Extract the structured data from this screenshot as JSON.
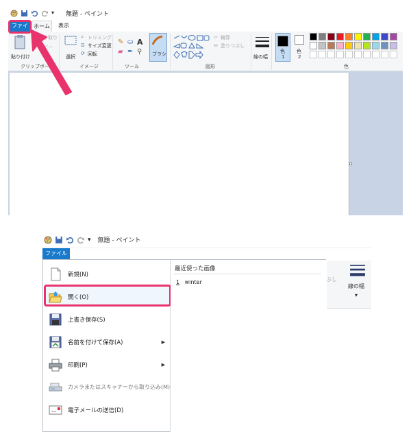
{
  "shot1": {
    "window_title": "無題 - ペイント",
    "tabs": {
      "file": "ファイル",
      "home": "ホーム",
      "view": "表示"
    },
    "ribbon": {
      "paste": "貼り付け",
      "cut": "切り取り",
      "copy": "コピー",
      "select": "選択",
      "crop": "トリミング",
      "resize": "サイズ変更",
      "rotate": "回転",
      "brushes": "ブラシ",
      "outline": "輪郭",
      "fill": "塗りつぶし",
      "size": "線の幅",
      "color1": "色",
      "color1_num": "1",
      "color2": "色",
      "color2_num": "2",
      "groups": {
        "clipboard": "クリップボード",
        "image": "イメージ",
        "tools": "ツール",
        "shapes": "図形",
        "colors": "色"
      }
    },
    "palette": [
      "#000000",
      "#7f7f7f",
      "#880015",
      "#ed1c24",
      "#ff7f27",
      "#fff200",
      "#22b14c",
      "#00a2e8",
      "#3f48cc",
      "#a349a4",
      "#ffffff",
      "#c3c3c3",
      "#b97a57",
      "#ffaec9",
      "#ffc90e",
      "#efe4b0",
      "#b5e61d",
      "#99d9ea",
      "#7092be",
      "#c8bfe7",
      "#ffffff",
      "#ffffff",
      "#ffffff",
      "#ffffff",
      "#ffffff",
      "#ffffff",
      "#ffffff",
      "#ffffff",
      "#ffffff",
      "#ffffff"
    ],
    "accent": "#e8336d"
  },
  "shot2": {
    "window_title": "無題 - ペイント",
    "file_tab": "ファイル",
    "menu_items": [
      {
        "label": "新規(N)"
      },
      {
        "label": "開く(O)"
      },
      {
        "label": "上書き保存(S)"
      },
      {
        "label": "名前を付けて保存(A)"
      },
      {
        "label": "印刷(P)"
      },
      {
        "label": "カメラまたはスキャナーから取り込み(M)"
      },
      {
        "label": "電子メールの送信(D)"
      }
    ],
    "recent": {
      "heading": "最近使った画像",
      "items": [
        {
          "index": "1",
          "name": "winter"
        }
      ]
    },
    "ribbon_peek": {
      "fill_partial": "ぶし",
      "size": "線の幅"
    }
  }
}
